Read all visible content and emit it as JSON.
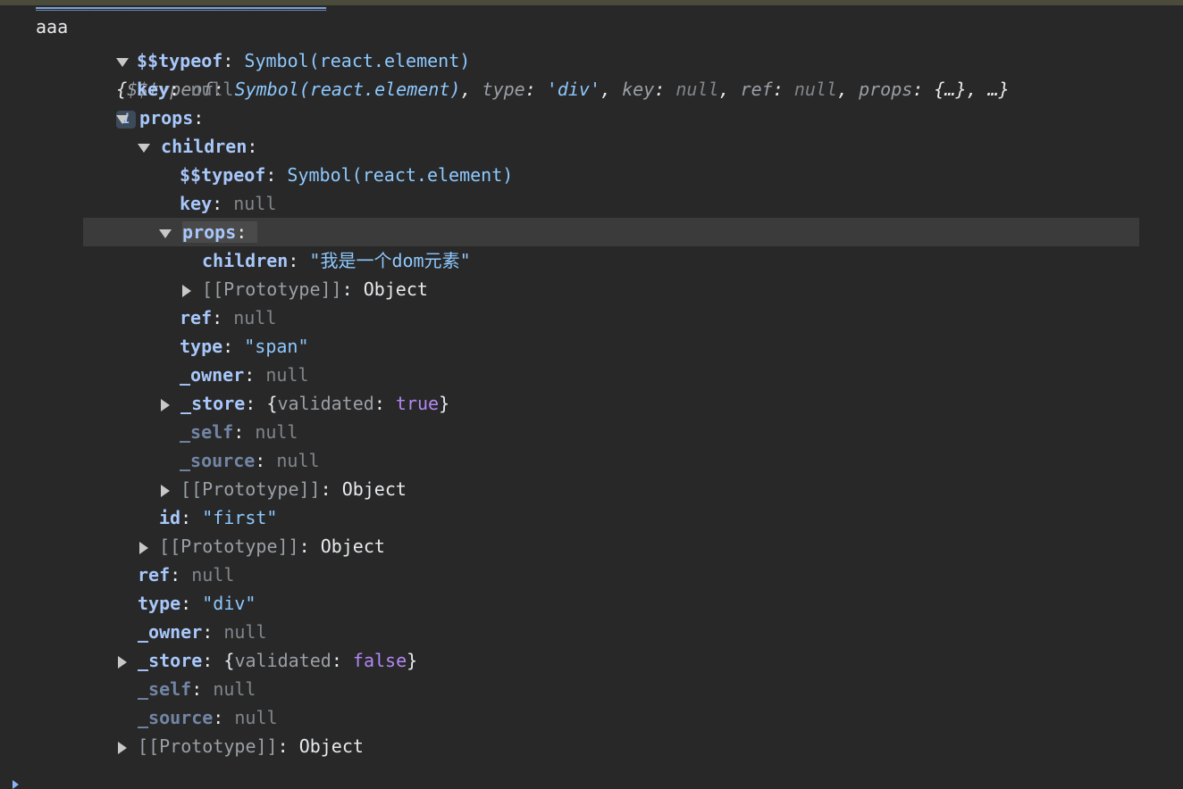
{
  "log_label": "aaa",
  "top_link_text": "___________________________",
  "preview": {
    "open": "{",
    "typeof_key": "$$typeof",
    "typeof_val": "Symbol(react.element)",
    "type_key": "type",
    "type_val": "'div'",
    "key_key": "key",
    "key_val": "null",
    "ref_key": "ref",
    "ref_val": "null",
    "props_key": "props",
    "props_val": "{…}",
    "tail": "…}",
    "info": "i"
  },
  "lines": {
    "l1_key": "$$typeof",
    "l1_val": "Symbol(react.element)",
    "l2_key": "key",
    "l2_val": "null",
    "l3_key": "props",
    "l4_key": "children",
    "l5_key": "$$typeof",
    "l5_val": "Symbol(react.element)",
    "l6_key": "key",
    "l6_val": "null",
    "l7_key": "props",
    "l8_key": "children",
    "l8_val": "\"我是一个dom元素\"",
    "l9_key": "[[Prototype]]",
    "l9_val": "Object",
    "l10_key": "ref",
    "l10_val": "null",
    "l11_key": "type",
    "l11_val": "\"span\"",
    "l12_key": "_owner",
    "l12_val": "null",
    "l13_key": "_store",
    "l13_open": "{",
    "l13_sub": "validated",
    "l13_bool": "true",
    "l13_close": "}",
    "l14_key": "_self",
    "l14_val": "null",
    "l15_key": "_source",
    "l15_val": "null",
    "l16_key": "[[Prototype]]",
    "l16_val": "Object",
    "l17_key": "id",
    "l17_val": "\"first\"",
    "l18_key": "[[Prototype]]",
    "l18_val": "Object",
    "l19_key": "ref",
    "l19_val": "null",
    "l20_key": "type",
    "l20_val": "\"div\"",
    "l21_key": "_owner",
    "l21_val": "null",
    "l22_key": "_store",
    "l22_open": "{",
    "l22_sub": "validated",
    "l22_bool": "false",
    "l22_close": "}",
    "l23_key": "_self",
    "l23_val": "null",
    "l24_key": "_source",
    "l24_val": "null",
    "l25_key": "[[Prototype]]",
    "l25_val": "Object"
  },
  "colors": {
    "background": "#282828",
    "key": "#a8c7fa",
    "string": "#8ec9ff",
    "null": "#80868b",
    "boolean": "#b387f5",
    "highlight_row": "#3b3b3b"
  }
}
